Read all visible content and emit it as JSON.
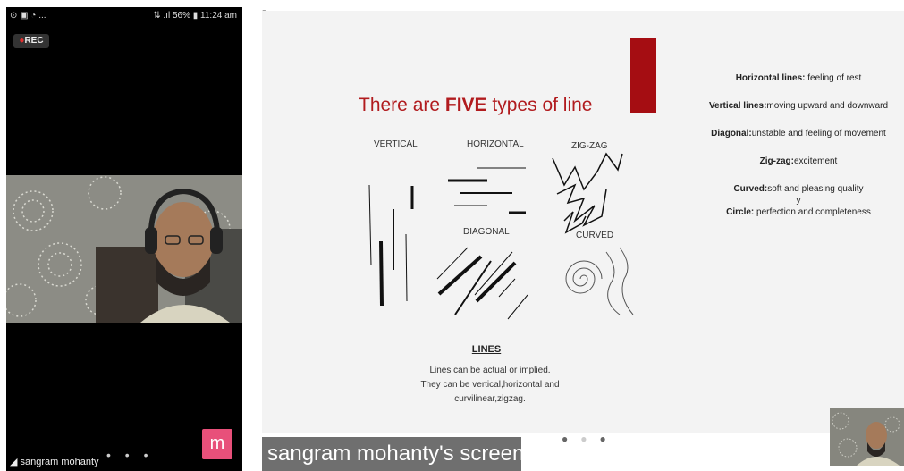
{
  "phone": {
    "status_left": "⊙ ▣ ◔ ...",
    "status_right": "⇅ .ıl 56% ▮ 11:24 am",
    "rec_label": "REC",
    "participant_name": "sangram mohanty",
    "more_dots": "• • •",
    "m_button": "m"
  },
  "slide": {
    "title_prefix": "There are ",
    "title_bold": "FIVE",
    "title_suffix": " types of line",
    "labels": {
      "vertical": "VERTICAL",
      "horizontal": "HORIZONTAL",
      "zigzag": "ZIG-ZAG",
      "diagonal": "DIAGONAL",
      "curved": "CURVED"
    },
    "definitions": [
      {
        "term": "Horizontal lines:",
        "desc": " feeling of rest"
      },
      {
        "term": "Vertical lines:",
        "desc": "moving upward and downward"
      },
      {
        "term": "Diagonal:",
        "desc": "unstable and feeling of movement"
      },
      {
        "term": "Zig-zag:",
        "desc": "excitement"
      },
      {
        "term": "Curved:",
        "desc": "soft and pleasing quality"
      },
      {
        "term": "",
        "desc": "y"
      },
      {
        "term": "Circle:",
        "desc": " perfection and completeness"
      }
    ],
    "lines_title": "LINES",
    "lines_text_1": "Lines can be actual or implied.",
    "lines_text_2": "They can be vertical,horizontal and",
    "lines_text_3": "curvilinear,zigzag."
  },
  "screen_label": "sangram mohanty's screen",
  "colors": {
    "accent_red": "#a50d12",
    "m_button": "#e8507a"
  }
}
